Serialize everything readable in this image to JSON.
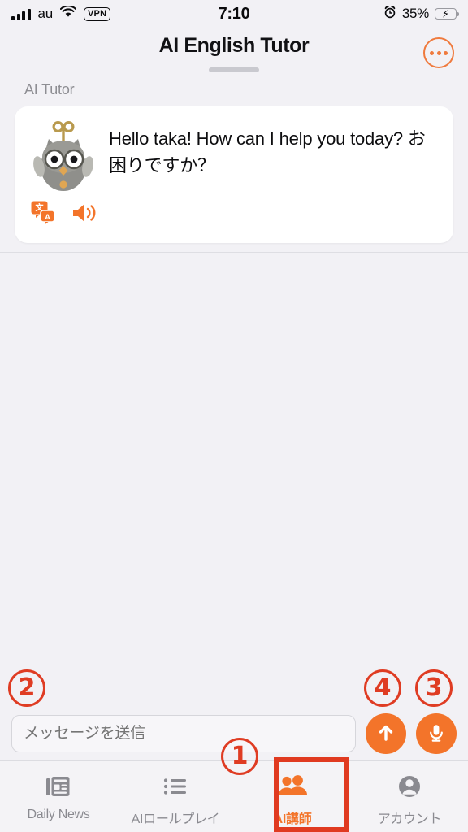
{
  "status_bar": {
    "carrier": "au",
    "vpn_badge": "VPN",
    "time": "7:10",
    "battery_percent": "35%",
    "signal_icon": "signal-bars-icon",
    "wifi_icon": "wifi-icon",
    "alarm_icon": "alarm-clock-icon",
    "battery_icon": "battery-charging-icon",
    "battery_color": "#37c84a"
  },
  "header": {
    "title": "AI English Tutor",
    "more_icon": "more-options-icon",
    "accent_color": "#ef7a3d"
  },
  "chat": {
    "sender_label": "AI Tutor",
    "message": "Hello taka! How can I help you today? お困りですか？",
    "avatar_icon": "mechanical-owl-avatar",
    "translate_icon": "translate-icon",
    "speaker_icon": "speaker-icon",
    "action_color": "#f3742a"
  },
  "input_bar": {
    "placeholder": "メッセージを送信",
    "value": "",
    "send_icon": "send-arrow-up-icon",
    "mic_icon": "microphone-icon",
    "button_color": "#f3742a"
  },
  "tab_bar": {
    "tabs": [
      {
        "label": "Daily News",
        "icon": "newspaper-icon",
        "active": false
      },
      {
        "label": "AIロールプレイ",
        "icon": "bullet-list-icon",
        "active": false
      },
      {
        "label": "AI講師",
        "icon": "people-icon",
        "active": true
      },
      {
        "label": "アカウント",
        "icon": "account-icon",
        "active": false
      }
    ],
    "active_color": "#f3742a",
    "inactive_color": "#8a8a90",
    "highlight_color": "#e03a20"
  },
  "annotations": {
    "marker_color": "#df3c23",
    "items": [
      {
        "id": "1",
        "label": "①",
        "target": "ai-tutor-tab"
      },
      {
        "id": "2",
        "label": "②",
        "target": "message-input"
      },
      {
        "id": "3",
        "label": "③",
        "target": "microphone-button"
      },
      {
        "id": "4",
        "label": "④",
        "target": "send-button"
      }
    ]
  }
}
